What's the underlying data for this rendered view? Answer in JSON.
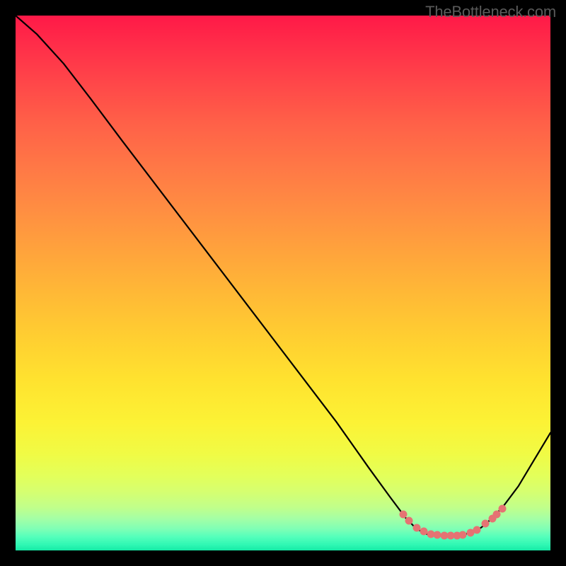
{
  "watermark": "TheBottleneck.com",
  "colors": {
    "curve_stroke": "#000000",
    "dot_fill": "#e57373"
  },
  "chart_data": {
    "type": "line",
    "title": "",
    "xlabel": "",
    "ylabel": "",
    "xlim": [
      0,
      100
    ],
    "ylim": [
      0,
      100
    ],
    "grid": false,
    "curve": {
      "description": "Bottleneck percentage curve; minimum near x≈78–85, peak (100) at x=0, rises toward right edge.",
      "points": [
        {
          "x": 0,
          "y": 100
        },
        {
          "x": 4,
          "y": 96.5
        },
        {
          "x": 9,
          "y": 91
        },
        {
          "x": 14,
          "y": 84.5
        },
        {
          "x": 20,
          "y": 76.5
        },
        {
          "x": 28,
          "y": 66
        },
        {
          "x": 36,
          "y": 55.5
        },
        {
          "x": 44,
          "y": 45
        },
        {
          "x": 52,
          "y": 34.5
        },
        {
          "x": 60,
          "y": 24
        },
        {
          "x": 66,
          "y": 15.5
        },
        {
          "x": 70,
          "y": 10
        },
        {
          "x": 73,
          "y": 6
        },
        {
          "x": 75,
          "y": 4
        },
        {
          "x": 77,
          "y": 3
        },
        {
          "x": 80,
          "y": 2.7
        },
        {
          "x": 83,
          "y": 2.8
        },
        {
          "x": 86,
          "y": 3.5
        },
        {
          "x": 88,
          "y": 5
        },
        {
          "x": 91,
          "y": 8
        },
        {
          "x": 94,
          "y": 12
        },
        {
          "x": 97,
          "y": 17
        },
        {
          "x": 100,
          "y": 22
        }
      ]
    },
    "highlight_dots": {
      "description": "Salmon dots along the curve in the trough region.",
      "points": [
        {
          "x": 72.5,
          "y": 6.8
        },
        {
          "x": 73.5,
          "y": 5.6
        },
        {
          "x": 75.0,
          "y": 4.2
        },
        {
          "x": 76.3,
          "y": 3.6
        },
        {
          "x": 77.6,
          "y": 3.1
        },
        {
          "x": 78.8,
          "y": 2.9
        },
        {
          "x": 80.2,
          "y": 2.8
        },
        {
          "x": 81.3,
          "y": 2.8
        },
        {
          "x": 82.5,
          "y": 2.8
        },
        {
          "x": 83.6,
          "y": 2.9
        },
        {
          "x": 85.0,
          "y": 3.3
        },
        {
          "x": 86.2,
          "y": 3.9
        },
        {
          "x": 87.8,
          "y": 5.0
        },
        {
          "x": 89.1,
          "y": 5.9
        },
        {
          "x": 90.0,
          "y": 6.8
        },
        {
          "x": 91.0,
          "y": 7.8
        }
      ]
    }
  }
}
